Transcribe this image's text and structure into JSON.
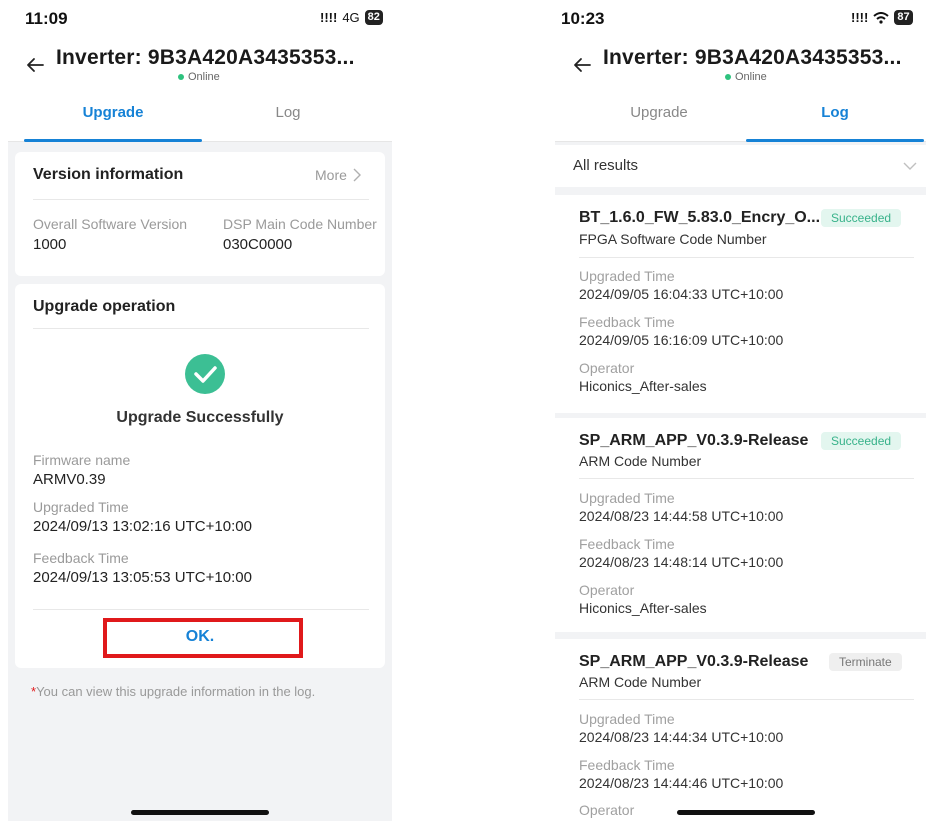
{
  "left": {
    "status": {
      "time": "11:09",
      "signal": "!!!!",
      "network": "4G",
      "battery": "82"
    },
    "header": {
      "title": "Inverter: 9B3A420A3435353...",
      "status": "Online"
    },
    "tabs": [
      "Upgrade",
      "Log"
    ],
    "version_card": {
      "title": "Version information",
      "more": "More",
      "fields": [
        {
          "label": "Overall Software Version",
          "value": "1000"
        },
        {
          "label": "DSP Main Code Number",
          "value": "030C0000"
        }
      ]
    },
    "operation_card": {
      "title": "Upgrade operation",
      "result": "Upgrade Successfully",
      "fields": [
        {
          "label": "Firmware name",
          "value": "ARMV0.39"
        },
        {
          "label": "Upgraded Time",
          "value": "2024/09/13 13:02:16 UTC+10:00"
        },
        {
          "label": "Feedback Time",
          "value": "2024/09/13 13:05:53 UTC+10:00"
        }
      ],
      "ok_button": "OK."
    },
    "note_star": "*",
    "note": "You can view this upgrade information in the log."
  },
  "right": {
    "status": {
      "time": "10:23",
      "signal": "!!!!",
      "battery": "87"
    },
    "header": {
      "title": "Inverter: 9B3A420A3435353...",
      "status": "Online"
    },
    "tabs": [
      "Upgrade",
      "Log"
    ],
    "filter": "All results",
    "logs": [
      {
        "name": "BT_1.6.0_FW_5.83.0_Encry_O...",
        "subtitle": "FPGA Software Code Number",
        "status": "Succeeded",
        "upgraded_label": "Upgraded Time",
        "upgraded": "2024/09/05 16:04:33 UTC+10:00",
        "feedback_label": "Feedback Time",
        "feedback": "2024/09/05 16:16:09 UTC+10:00",
        "operator_label": "Operator",
        "operator": "Hiconics_After-sales"
      },
      {
        "name": "SP_ARM_APP_V0.3.9-Release",
        "subtitle": "ARM Code Number",
        "status": "Succeeded",
        "upgraded_label": "Upgraded Time",
        "upgraded": "2024/08/23 14:44:58 UTC+10:00",
        "feedback_label": "Feedback Time",
        "feedback": "2024/08/23 14:48:14 UTC+10:00",
        "operator_label": "Operator",
        "operator": "Hiconics_After-sales"
      },
      {
        "name": "SP_ARM_APP_V0.3.9-Release",
        "subtitle": "ARM Code Number",
        "status": "Terminate",
        "upgraded_label": "Upgraded Time",
        "upgraded": "2024/08/23 14:44:34 UTC+10:00",
        "feedback_label": "Feedback Time",
        "feedback": "2024/08/23 14:44:46 UTC+10:00",
        "operator_label": "Operator"
      }
    ]
  },
  "colors": {
    "accent": "#1682d6",
    "success": "#3cbf94",
    "highlight": "#e0191b",
    "online": "#2ec27e"
  }
}
